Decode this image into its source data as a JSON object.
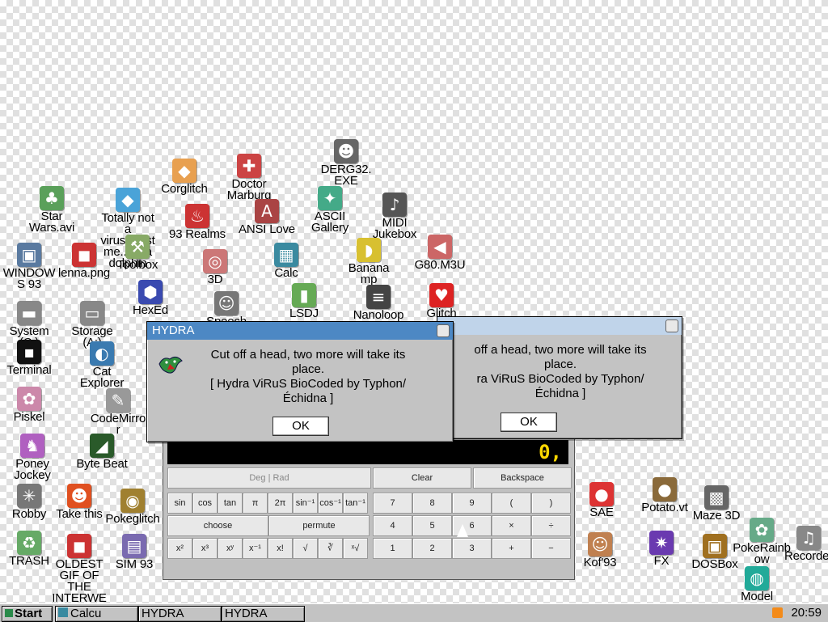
{
  "desktop": {
    "icons": [
      {
        "label": "Star Wars.avi",
        "glyph": "♣",
        "color": "#5aa05a"
      },
      {
        "label": "Totally not a virus.Trust me...im a dolphin",
        "glyph": "◆",
        "color": "#4aa3d8"
      },
      {
        "label": "Corglitch",
        "glyph": "◆",
        "color": "#e8a050"
      },
      {
        "label": "Doctor Marburg",
        "glyph": "✚",
        "color": "#c44"
      },
      {
        "label": "DERG32.EXE",
        "glyph": "☻",
        "color": "#666"
      },
      {
        "label": "93 Realms",
        "glyph": "♨",
        "color": "#c33"
      },
      {
        "label": "ANSI Love",
        "glyph": "A",
        "color": "#a44"
      },
      {
        "label": "ASCII Gallery",
        "glyph": "✦",
        "color": "#4a8"
      },
      {
        "label": "MIDI Jukebox",
        "glyph": "♪",
        "color": "#555"
      },
      {
        "label": "WINDOWS 93",
        "glyph": "▣",
        "color": "#5a7aa0"
      },
      {
        "label": "lenna.png",
        "glyph": "◼",
        "color": "#c33"
      },
      {
        "label": "Toolbox",
        "glyph": "⚒",
        "color": "#8a6"
      },
      {
        "label": "3D",
        "glyph": "◎",
        "color": "#c77"
      },
      {
        "label": "Calc",
        "glyph": "▦",
        "color": "#3a8aa0"
      },
      {
        "label": "Banana mp",
        "glyph": "◗",
        "color": "#d8c030"
      },
      {
        "label": "G80.M3U",
        "glyph": "◀",
        "color": "#c66"
      },
      {
        "label": "HexEd",
        "glyph": "⬢",
        "color": "#3a4ab0"
      },
      {
        "label": "Speech",
        "glyph": "☺",
        "color": "#777"
      },
      {
        "label": "LSDJ",
        "glyph": "▮",
        "color": "#6a5"
      },
      {
        "label": "Nanoloop",
        "glyph": "≡",
        "color": "#444"
      },
      {
        "label": "Glitch",
        "glyph": "♥",
        "color": "#d22"
      },
      {
        "label": "System (C:)",
        "glyph": "▬",
        "color": "#888"
      },
      {
        "label": "Storage (A:)",
        "glyph": "▭",
        "color": "#888"
      },
      {
        "label": "Terminal",
        "glyph": "▪",
        "color": "#111"
      },
      {
        "label": "Cat Explorer",
        "glyph": "◐",
        "color": "#3a7ab0"
      },
      {
        "label": "Piskel",
        "glyph": "✿",
        "color": "#c8a"
      },
      {
        "label": "CodeMirror",
        "glyph": "✎",
        "color": "#999"
      },
      {
        "label": "Poney Jockey",
        "glyph": "♞",
        "color": "#b060c0"
      },
      {
        "label": "Byte Beat",
        "glyph": "◢",
        "color": "#2a5a2a"
      },
      {
        "label": "Robby",
        "glyph": "✳",
        "color": "#777"
      },
      {
        "label": "Take this",
        "glyph": "☻",
        "color": "#e05020"
      },
      {
        "label": "Pokeglitch",
        "glyph": "◉",
        "color": "#a08030"
      },
      {
        "label": "TRASH",
        "glyph": "♻",
        "color": "#6a6"
      },
      {
        "label": "OLDEST GIF OF THE INTERWEBZ",
        "glyph": "◼",
        "color": "#c33"
      },
      {
        "label": "SIM 93",
        "glyph": "▤",
        "color": "#7a6ab0"
      },
      {
        "label": "SAE",
        "glyph": "●",
        "color": "#d33"
      },
      {
        "label": "Potato.vt",
        "glyph": "●",
        "color": "#8a6a3a"
      },
      {
        "label": "Maze 3D",
        "glyph": "▩",
        "color": "#666"
      },
      {
        "label": "Kof'93",
        "glyph": "☺",
        "color": "#c08050"
      },
      {
        "label": "FX",
        "glyph": "✷",
        "color": "#6a3ab0"
      },
      {
        "label": "DOSBox",
        "glyph": "▣",
        "color": "#a07020"
      },
      {
        "label": "PokeRainbow",
        "glyph": "✿",
        "color": "#6a8"
      },
      {
        "label": "Recorder",
        "glyph": "♫",
        "color": "#888"
      },
      {
        "label": "Model BeepB",
        "glyph": "◍",
        "color": "#2a9"
      }
    ]
  },
  "dialog_front": {
    "title": "HYDRA",
    "line1": "Cut off a head, two more will take its",
    "line2": "place.",
    "line3": "[ Hydra ViRuS BioCoded by Typhon/",
    "line4": "Échidna ]",
    "ok_label": "OK"
  },
  "dialog_back": {
    "line1": "off a head, two more will take its",
    "line2": "place.",
    "line3": "ra ViRuS BioCoded by Typhon/",
    "line4": "Échidna ]",
    "ok_label": "OK"
  },
  "calculator": {
    "display": "0,",
    "mode": "Deg | Rad",
    "clear": "Clear",
    "backspace": "Backspace",
    "sci_row1": [
      "sin",
      "cos",
      "tan",
      "π",
      "2π",
      "sin⁻¹",
      "cos⁻¹",
      "tan⁻¹"
    ],
    "sci_row2": [
      "choose",
      "permute"
    ],
    "sci_row3": [
      "x²",
      "x³",
      "xʸ",
      "x⁻¹",
      "x!",
      "√",
      "∛",
      "ˣ√"
    ],
    "num_row1": [
      "7",
      "8",
      "9",
      "(",
      ")"
    ],
    "num_row2": [
      "4",
      "5",
      "6",
      "×",
      "÷"
    ],
    "num_row3": [
      "1",
      "2",
      "3",
      "+",
      "−"
    ]
  },
  "taskbar": {
    "start_label": "Start",
    "items": [
      "Calcu",
      "HYDRA",
      "HYDRA"
    ],
    "clock": "20:59"
  }
}
